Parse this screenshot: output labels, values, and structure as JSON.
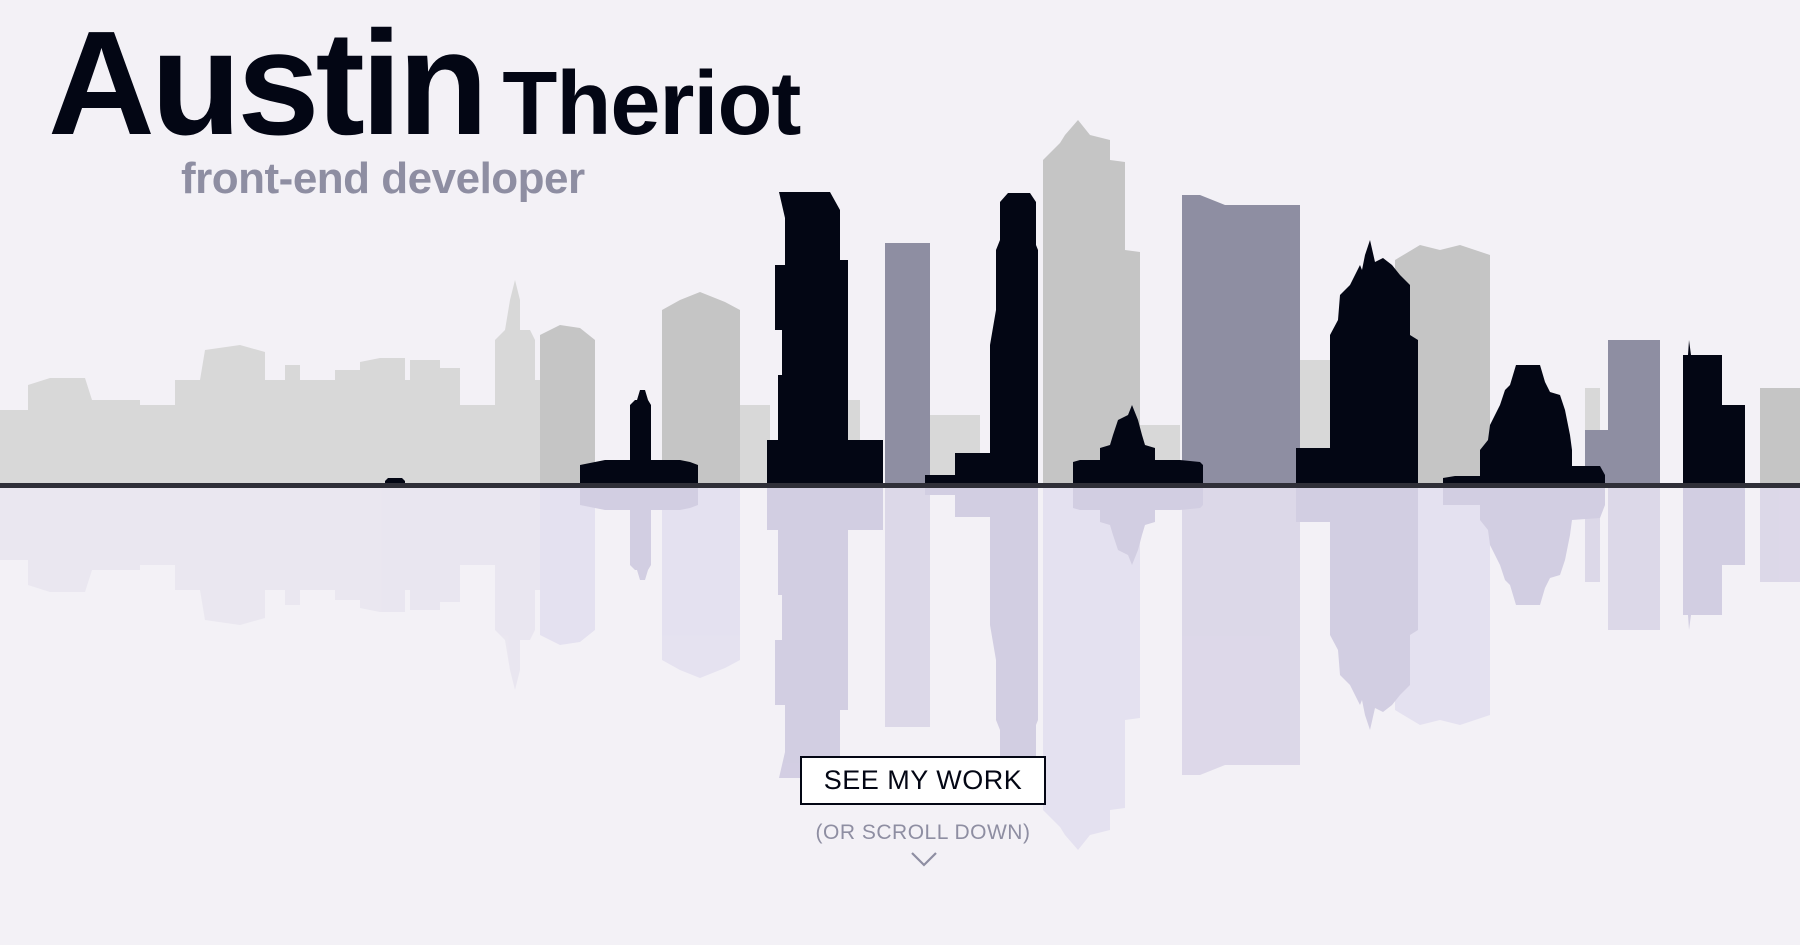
{
  "header": {
    "first_name": "Austin",
    "last_name": "Theriot",
    "tagline": "front-end developer"
  },
  "cta": {
    "button_label": "SEE MY WORK",
    "scroll_hint": "(OR SCROLL DOWN)"
  },
  "icons": {
    "scroll_down": "chevron-down-icon",
    "skyline": "city-skyline-illustration"
  },
  "colors": {
    "background": "#f3f1f6",
    "dark": "#030614",
    "accent_gray": "#8e8ea2",
    "light_gray": "#c5c5c5",
    "far_gray": "#d8d8d8",
    "reflection": "#cdc8df"
  }
}
